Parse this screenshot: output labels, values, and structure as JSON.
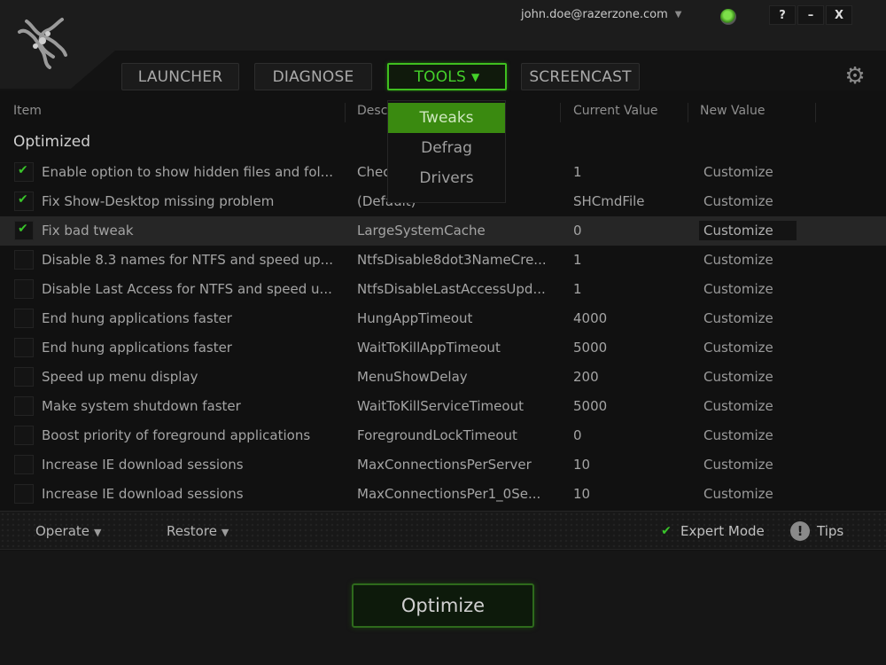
{
  "app": {
    "brand": "Razer"
  },
  "account": {
    "email": "john.doe@razerzone.com",
    "status": "online"
  },
  "window_buttons": {
    "help": "?",
    "minimize": "–",
    "close": "X"
  },
  "nav": {
    "tabs": [
      {
        "label": "LAUNCHER",
        "active": false
      },
      {
        "label": "DIAGNOSE",
        "active": false
      },
      {
        "label": "TOOLS",
        "active": true
      },
      {
        "label": "SCREENCAST",
        "active": false
      }
    ],
    "dropdown_arrow": "▼",
    "settings_icon": "gear-icon"
  },
  "tools_menu": {
    "items": [
      {
        "label": "Tweaks",
        "active": true
      },
      {
        "label": "Defrag",
        "active": false
      },
      {
        "label": "Drivers",
        "active": false
      }
    ]
  },
  "table": {
    "columns": [
      "Item",
      "Description",
      "Current Value",
      "New Value"
    ],
    "columns_visible": [
      "Item",
      "Desc",
      "Current Value",
      "New Value"
    ],
    "section": "Optimized",
    "rows": [
      {
        "checked": true,
        "item": "Enable option to show hidden files and fol...",
        "desc": "Chec",
        "current": "1",
        "new": "Customize"
      },
      {
        "checked": true,
        "item": "Fix Show-Desktop missing problem",
        "desc": "(Default)",
        "current": "SHCmdFile",
        "new": "Customize"
      },
      {
        "checked": true,
        "item": "Fix bad tweak",
        "desc": "LargeSystemCache",
        "current": "0",
        "new": "Customize",
        "selected": true
      },
      {
        "checked": false,
        "item": "Disable 8.3 names for NTFS and speed up...",
        "desc": "NtfsDisable8dot3NameCre...",
        "current": "1",
        "new": "Customize"
      },
      {
        "checked": false,
        "item": "Disable Last Access for NTFS and speed u...",
        "desc": "NtfsDisableLastAccessUpd...",
        "current": "1",
        "new": "Customize"
      },
      {
        "checked": false,
        "item": "End hung applications faster",
        "desc": "HungAppTimeout",
        "current": "4000",
        "new": "Customize"
      },
      {
        "checked": false,
        "item": "End hung applications faster",
        "desc": "WaitToKillAppTimeout",
        "current": "5000",
        "new": "Customize"
      },
      {
        "checked": false,
        "item": "Speed up menu display",
        "desc": "MenuShowDelay",
        "current": "200",
        "new": "Customize"
      },
      {
        "checked": false,
        "item": "Make system shutdown faster",
        "desc": "WaitToKillServiceTimeout",
        "current": "5000",
        "new": "Customize"
      },
      {
        "checked": false,
        "item": "Boost priority of foreground applications",
        "desc": "ForegroundLockTimeout",
        "current": "0",
        "new": "Customize"
      },
      {
        "checked": false,
        "item": "Increase IE download sessions",
        "desc": "MaxConnectionsPerServer",
        "current": "10",
        "new": "Customize"
      },
      {
        "checked": false,
        "item": "Increase IE download sessions",
        "desc": "MaxConnectionsPer1_0Se...",
        "current": "10",
        "new": "Customize"
      }
    ]
  },
  "bottom_bar": {
    "operate": "Operate",
    "restore": "Restore",
    "arrow": "▼",
    "expert_mode": {
      "label": "Expert Mode",
      "checked": true
    },
    "tips": "Tips"
  },
  "footer": {
    "optimize_label": "Optimize"
  },
  "colors": {
    "accent": "#44d12a",
    "menu_active": "#3a8a10",
    "background": "#111111"
  }
}
